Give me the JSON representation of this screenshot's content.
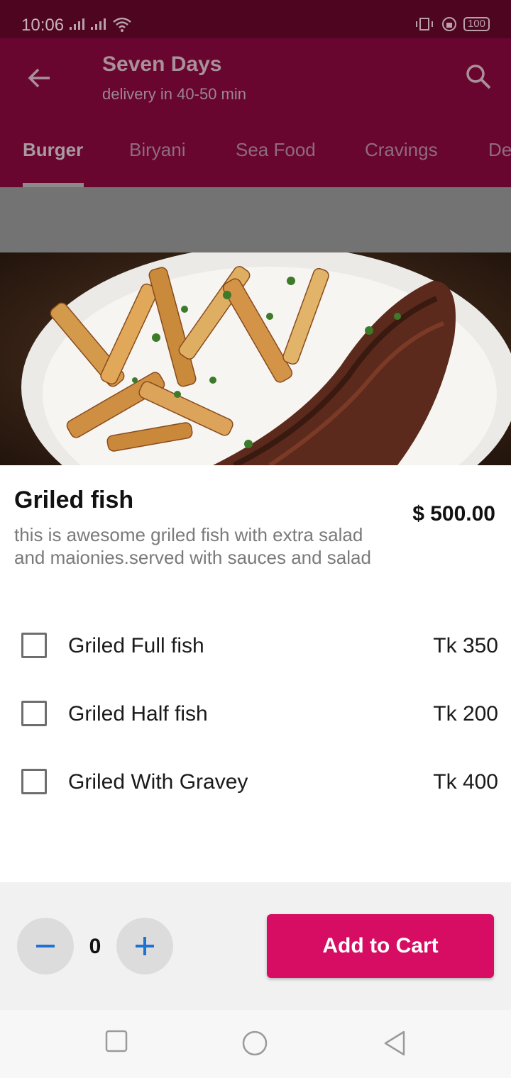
{
  "status_bar": {
    "time": "10:06",
    "battery": "100"
  },
  "app_bar": {
    "title": "Seven Days",
    "subtitle": "delivery in 40-50 min",
    "tabs": [
      "Burger",
      "Biryani",
      "Sea Food",
      "Cravings",
      "De"
    ],
    "active_tab": "Burger"
  },
  "item": {
    "name": "Griled fish",
    "price": "$ 500.00",
    "description": "this is awesome griled fish with extra salad and maionies.served with sauces and salad"
  },
  "options": [
    {
      "label": "Griled Full fish",
      "price": "Tk 350"
    },
    {
      "label": "Griled Half fish",
      "price": "Tk 200"
    },
    {
      "label": "Griled With Gravey",
      "price": "Tk 400"
    }
  ],
  "cart": {
    "quantity": "0",
    "add_label": "Add to Cart"
  },
  "colors": {
    "status_bar": "#4d0520",
    "app_bar": "#680630",
    "accent": "#d60d62",
    "icon_blue": "#1e73d2"
  },
  "icons": {
    "back": "arrow-left-icon",
    "search": "search-icon",
    "minus": "minus-icon",
    "plus": "plus-icon"
  }
}
